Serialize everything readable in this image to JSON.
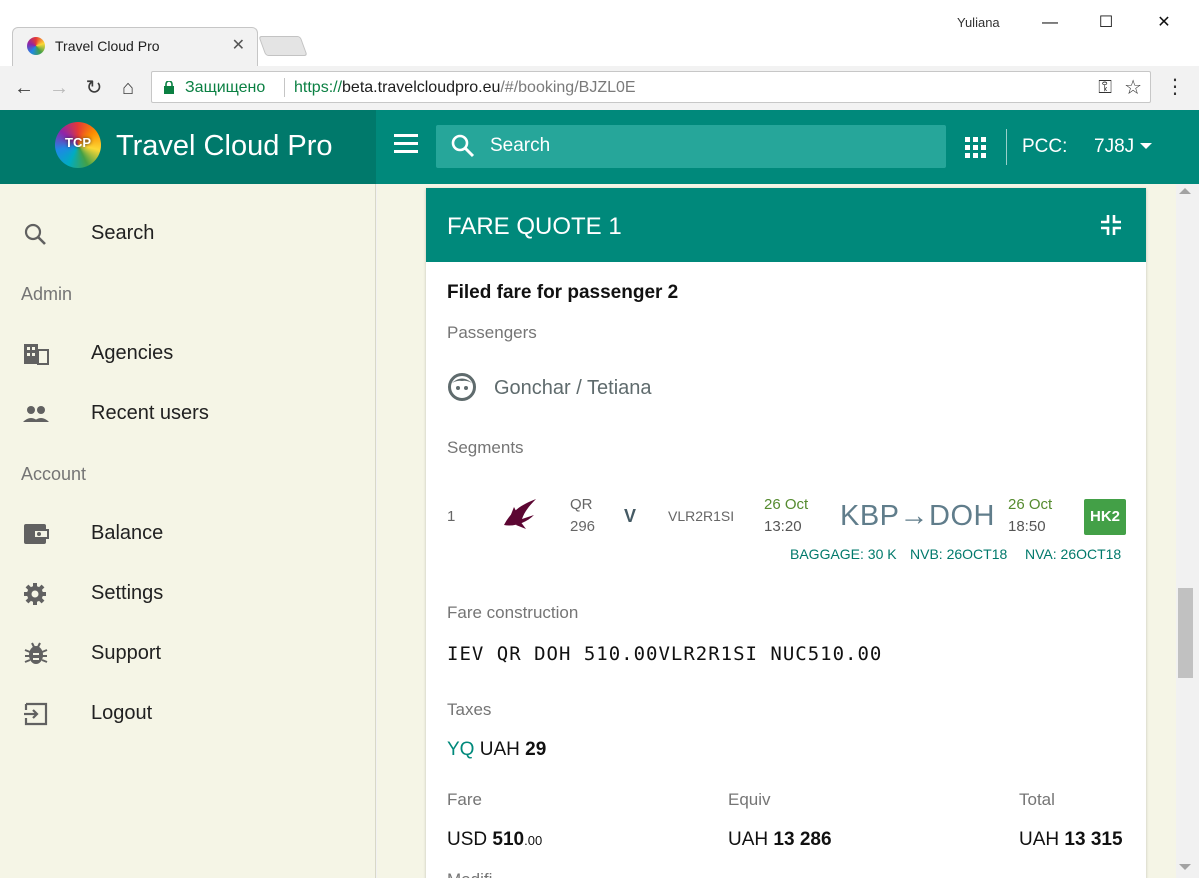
{
  "browser": {
    "tab_title": "Travel Cloud Pro",
    "user": "Yuliana",
    "secure_label": "Защищено",
    "url_scheme": "https://",
    "url_host": "beta.travelcloudpro.eu",
    "url_path": "/#/booking/BJZL0E"
  },
  "header": {
    "logo_text": "TCP",
    "brand_name": "Travel Cloud Pro",
    "search_placeholder": "Search",
    "pcc_label": "PCC:",
    "pcc_value": "7J8J"
  },
  "sidebar": {
    "items": [
      {
        "label": "Search",
        "icon": "search-icon"
      },
      {
        "label": "Agencies",
        "icon": "building-icon"
      },
      {
        "label": "Recent users",
        "icon": "people-icon"
      },
      {
        "label": "Balance",
        "icon": "wallet-icon"
      },
      {
        "label": "Settings",
        "icon": "gear-icon"
      },
      {
        "label": "Support",
        "icon": "bug-icon"
      },
      {
        "label": "Logout",
        "icon": "logout-icon"
      }
    ],
    "sections": {
      "admin": "Admin",
      "account": "Account"
    }
  },
  "fare_quote": {
    "title": "FARE QUOTE 1",
    "heading": "Filed fare for passenger 2",
    "passengers_label": "Passengers",
    "passenger_name": "Gonchar / Tetiana",
    "segments_label": "Segments",
    "segment": {
      "number": "1",
      "airline_code": "QR",
      "flight_number": "296",
      "booking_class": "V",
      "fare_basis": "VLR2R1SI",
      "dep_date": "26 Oct",
      "dep_time": "13:20",
      "route": "KBP→DOH",
      "arr_date": "26 Oct",
      "arr_time": "18:50",
      "status": "HK2",
      "baggage": "BAGGAGE: 30 K",
      "nvb": "NVB: 26OCT18",
      "nva": "NVA: 26OCT18"
    },
    "fare_construction_label": "Fare construction",
    "fare_construction": "IEV QR DOH 510.00VLR2R1SI NUC510.00",
    "taxes_label": "Taxes",
    "tax": {
      "code": "YQ",
      "currency": "UAH",
      "amount": "29"
    },
    "fare_label": "Fare",
    "fare": {
      "currency": "USD",
      "amount": "510",
      "decimals": ".00"
    },
    "equiv_label": "Equiv",
    "equiv": {
      "currency": "UAH",
      "amount": "13 286"
    },
    "total_label": "Total",
    "total": {
      "currency": "UAH",
      "amount": "13 315"
    },
    "modifiers_label": "Modifi..."
  },
  "colors": {
    "primary": "#00897b",
    "primary_dark": "#00796b",
    "sidebar_bg": "#f5f5e6",
    "status_green": "#43a047"
  }
}
